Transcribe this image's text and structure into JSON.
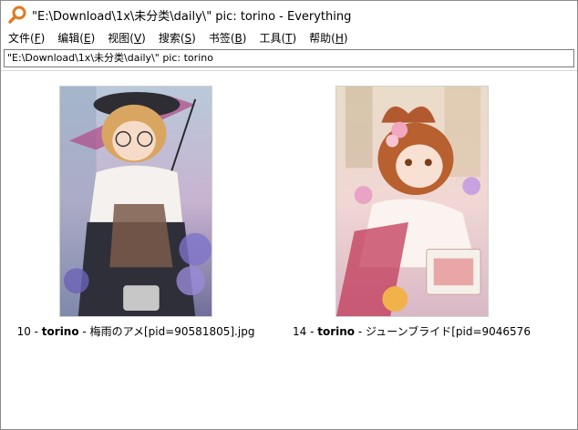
{
  "window": {
    "title": "\"E:\\Download\\1x\\未分类\\daily\\\" pic: torino  - Everything"
  },
  "menu": {
    "items": [
      {
        "label": "文件(",
        "key": "F",
        "suffix": ")"
      },
      {
        "label": "编辑(",
        "key": "E",
        "suffix": ")"
      },
      {
        "label": "视图(",
        "key": "V",
        "suffix": ")"
      },
      {
        "label": "搜索(",
        "key": "S",
        "suffix": ")"
      },
      {
        "label": "书签(",
        "key": "B",
        "suffix": ")"
      },
      {
        "label": "工具(",
        "key": "T",
        "suffix": ")"
      },
      {
        "label": "帮助(",
        "key": "H",
        "suffix": ")"
      }
    ]
  },
  "search": {
    "value": "\"E:\\Download\\1x\\未分类\\daily\\\" pic: torino"
  },
  "results": [
    {
      "prefix": "10 - ",
      "bold": "torino",
      "mid": " - 梅雨のアメ[pid=90581805]",
      "ext": ".jpg"
    },
    {
      "prefix": "14 - ",
      "bold": "torino",
      "mid": " - ジューンブライド[pid=9046576...",
      "ext": ""
    }
  ],
  "colors": {
    "accent": "#e07a1f"
  }
}
